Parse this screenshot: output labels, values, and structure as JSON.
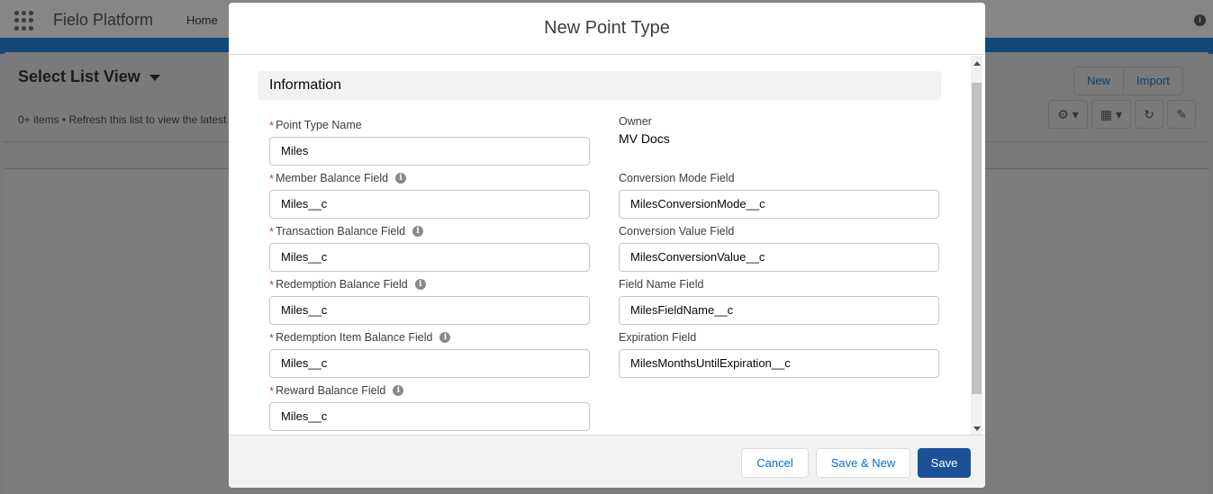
{
  "app": {
    "name": "Fielo Platform",
    "nav_home": "Home"
  },
  "list_view": {
    "title": "Select List View",
    "subtitle": "0+ items • Refresh this list to view the latest",
    "buttons": {
      "new": "New",
      "import": "Import"
    }
  },
  "modal": {
    "title": "New Point Type",
    "section": "Information",
    "left_fields": [
      {
        "label": "Point Type Name",
        "value": "Miles",
        "required": true,
        "help": false
      },
      {
        "label": "Member Balance Field",
        "value": "Miles__c",
        "required": true,
        "help": true
      },
      {
        "label": "Transaction Balance Field",
        "value": "Miles__c",
        "required": true,
        "help": true
      },
      {
        "label": "Redemption Balance Field",
        "value": "Miles__c",
        "required": true,
        "help": true
      },
      {
        "label": "Redemption Item Balance Field",
        "value": "Miles__c",
        "required": true,
        "help": true
      },
      {
        "label": "Reward Balance Field",
        "value": "Miles__c",
        "required": true,
        "help": true
      }
    ],
    "owner": {
      "label": "Owner",
      "value": "MV Docs"
    },
    "right_fields": [
      {
        "label": "Conversion Mode Field",
        "value": "MilesConversionMode__c"
      },
      {
        "label": "Conversion Value Field",
        "value": "MilesConversionValue__c"
      },
      {
        "label": "Field Name Field",
        "value": "MilesFieldName__c"
      },
      {
        "label": "Expiration Field",
        "value": "MilesMonthsUntilExpiration__c"
      }
    ],
    "footer": {
      "cancel": "Cancel",
      "save_new": "Save & New",
      "save": "Save"
    }
  },
  "colors": {
    "brand_button": "#1b5297",
    "required": "#c23934",
    "link": "#0070d2"
  },
  "icons": {
    "help": "info-circle-icon",
    "launcher": "app-launcher-icon",
    "settings": "gear-icon",
    "table": "table-icon",
    "refresh": "refresh-icon",
    "edit": "pencil-icon"
  }
}
